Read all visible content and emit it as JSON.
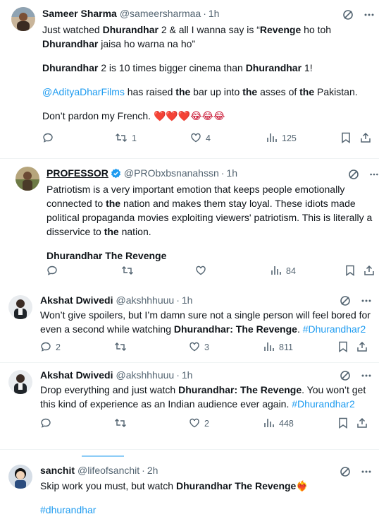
{
  "tweets": [
    {
      "name": "Sameer Sharma",
      "handle": "@sameersharmaa",
      "sep": "·",
      "time": "1h",
      "lines": [
        [
          "Just watched ",
          {
            "b": "Dhurandhar"
          },
          " 2 & all I wanna say is “",
          {
            "b": "Revenge"
          },
          " ho toh"
        ],
        [
          {
            "b": "Dhurandhar"
          },
          " jaisa ho warna na ho”"
        ],
        null,
        [
          {
            "b": "Dhurandhar"
          },
          " 2 is 10 times bigger cinema than ",
          {
            "b": "Dhurandhar"
          },
          " 1!"
        ],
        null,
        [
          {
            "l": "@AdityaDharFilms"
          },
          " has raised ",
          {
            "b": "the"
          },
          " bar up into ",
          {
            "b": "the"
          },
          " asses of ",
          {
            "b": "the"
          },
          " Pakistan."
        ],
        null,
        [
          "Don’t pardon my French. ",
          {
            "e": "❤️❤️❤️😂😂😂"
          }
        ]
      ],
      "replies": "",
      "retweets": "1",
      "likes": "4",
      "views": "125"
    },
    {
      "name": "PROFESSOR",
      "handle": "@PRObxbsnanahssn",
      "sep": "·",
      "time": "1h",
      "lines": [
        [
          "Patriotism is a very important emotion that keeps people emotionally"
        ],
        [
          "connected to ",
          {
            "b": "the"
          },
          " nation and makes them stay loyal. These idiots made"
        ],
        [
          "political propaganda movies exploiting viewers' patriotism. This is literally a"
        ],
        [
          "disservice to ",
          {
            "b": "the"
          },
          " nation."
        ],
        null,
        [
          {
            "b": "Dhurandhar The Revenge"
          }
        ]
      ],
      "replies": "",
      "retweets": "",
      "likes": "",
      "views": "84"
    },
    {
      "name": "Akshat Dwivedi",
      "handle": "@akshhhuuu",
      "sep": "·",
      "time": "1h",
      "lines": [
        [
          "Won’t give spoilers, but I’m damn sure not a single person will feel bored for"
        ],
        [
          "even a second while watching ",
          {
            "b": "Dhurandhar: The Revenge"
          },
          ". ",
          {
            "l": "#Dhurandhar2"
          }
        ]
      ],
      "replies": "2",
      "retweets": "",
      "likes": "3",
      "views": "811"
    },
    {
      "name": "Akshat Dwivedi",
      "handle": "@akshhhuuu",
      "sep": "·",
      "time": "1h",
      "lines": [
        [
          "Drop everything and just watch ",
          {
            "b": "Dhurandhar: The Revenge"
          },
          ". You won’t get"
        ],
        [
          "this kind of experience as an Indian audience ever again. ",
          {
            "l": "#Dhurandhar2"
          }
        ]
      ],
      "replies": "",
      "retweets": "",
      "likes": "2",
      "views": "448"
    },
    {
      "name": "sanchit",
      "handle": "@lifeofsanchit",
      "sep": "·",
      "time": "2h",
      "lines": [
        [
          "Skip work you must, but watch ",
          {
            "b": "Dhurandhar The Revenge"
          },
          {
            "e": "❤️‍🔥"
          }
        ],
        null,
        [
          {
            "l": "#dhurandhar"
          }
        ]
      ],
      "replies": "",
      "retweets": "",
      "likes": "",
      "views": ""
    }
  ],
  "colors": {
    "link": "#1d9bf0",
    "muted": "#536471",
    "text": "#0f1419",
    "verified": "#1d9bf0"
  },
  "icons": [
    "reply-icon",
    "retweet-icon",
    "like-icon",
    "views-icon",
    "bookmark-icon",
    "share-icon",
    "grok-icon",
    "more-icon",
    "verified-badge-icon"
  ]
}
